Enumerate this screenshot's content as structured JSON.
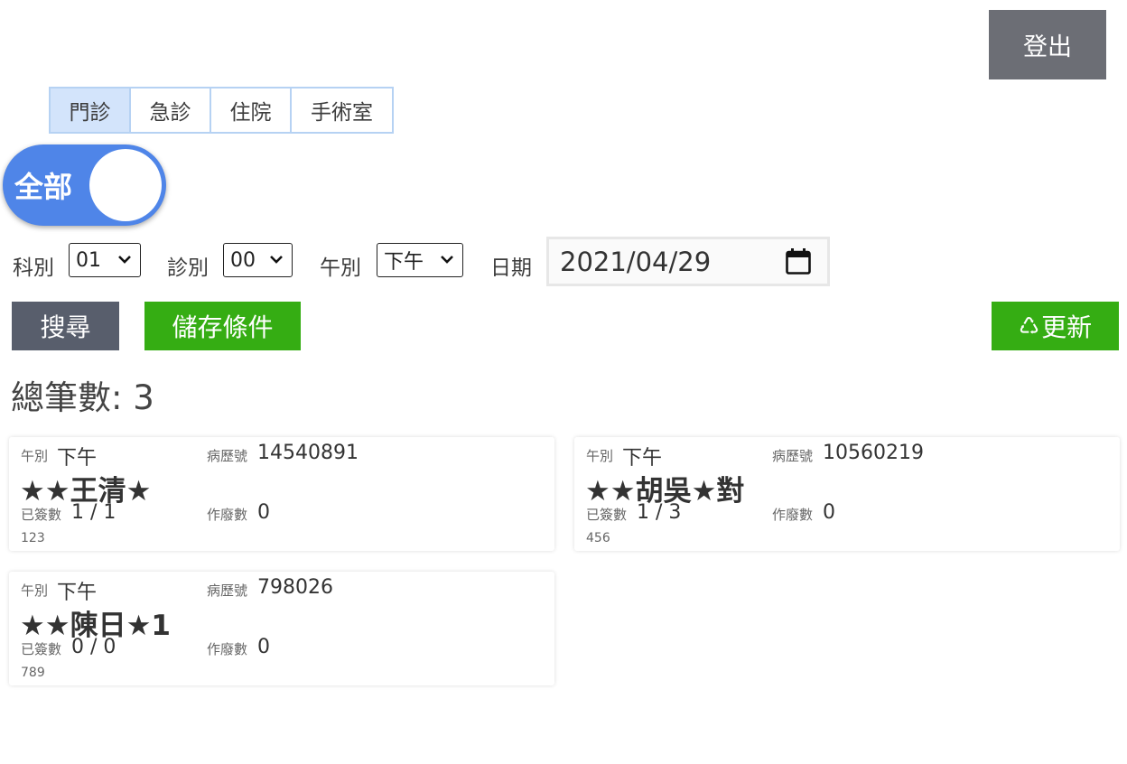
{
  "header": {
    "logout_label": "登出"
  },
  "tabs": [
    {
      "label": "門診",
      "active": true
    },
    {
      "label": "急診",
      "active": false
    },
    {
      "label": "住院",
      "active": false
    },
    {
      "label": "手術室",
      "active": false
    }
  ],
  "toggle": {
    "label": "全部",
    "on": true
  },
  "filters": {
    "dept": {
      "label": "科別",
      "value": "01"
    },
    "clinic": {
      "label": "診別",
      "value": "00"
    },
    "session": {
      "label": "午別",
      "value": "下午"
    },
    "date": {
      "label": "日期",
      "value": "2021/04/29"
    }
  },
  "actions": {
    "search_label": "搜尋",
    "save_label": "儲存條件",
    "refresh_icon": "♺",
    "refresh_label": "更新"
  },
  "summary": {
    "total_text": "總筆數: 3"
  },
  "card_labels": {
    "session": "午別",
    "record_no": "病歷號",
    "signed": "已簽數",
    "voided": "作廢數"
  },
  "cards": [
    {
      "session": "下午",
      "record_no": "14540891",
      "name": "★★王清★",
      "signed": "1 / 1",
      "voided": "0",
      "note": "123"
    },
    {
      "session": "下午",
      "record_no": "10560219",
      "name": "★★胡吳★對",
      "signed": "1 / 3",
      "voided": "0",
      "note": "456"
    },
    {
      "session": "下午",
      "record_no": "798026",
      "name": "★★陳日★1",
      "signed": "0 / 0",
      "voided": "0",
      "note": "789"
    }
  ],
  "colors": {
    "logout_bg": "#6c6e75",
    "tab_active_bg": "#d3e4fb",
    "tab_border": "#b6d2f3",
    "toggle_bg": "#4f85e8",
    "search_bg": "#585e6c",
    "green": "#35ad13"
  }
}
